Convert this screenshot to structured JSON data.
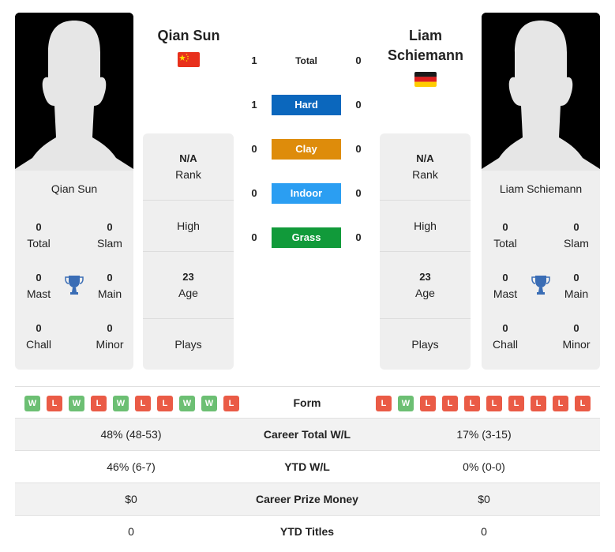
{
  "players": {
    "left": {
      "name": "Qian Sun",
      "country": "China",
      "flag_icon": "china-flag-icon",
      "rank": "N/A",
      "rank_label": "Rank",
      "high_label": "High",
      "age": "23",
      "age_label": "Age",
      "plays_label": "Plays",
      "titles": {
        "total": "0",
        "total_label": "Total",
        "slam": "0",
        "slam_label": "Slam",
        "mast": "0",
        "mast_label": "Mast",
        "main": "0",
        "main_label": "Main",
        "chall": "0",
        "chall_label": "Chall",
        "minor": "0",
        "minor_label": "Minor"
      },
      "form": [
        "W",
        "L",
        "W",
        "L",
        "W",
        "L",
        "L",
        "W",
        "W",
        "L"
      ]
    },
    "right": {
      "name": "Liam Schiemann",
      "name_line1": "Liam",
      "name_line2": "Schiemann",
      "country": "Germany",
      "flag_icon": "germany-flag-icon",
      "rank": "N/A",
      "rank_label": "Rank",
      "high_label": "High",
      "age": "23",
      "age_label": "Age",
      "plays_label": "Plays",
      "titles": {
        "total": "0",
        "total_label": "Total",
        "slam": "0",
        "slam_label": "Slam",
        "mast": "0",
        "mast_label": "Mast",
        "main": "0",
        "main_label": "Main",
        "chall": "0",
        "chall_label": "Chall",
        "minor": "0",
        "minor_label": "Minor"
      },
      "form": [
        "L",
        "W",
        "L",
        "L",
        "L",
        "L",
        "L",
        "L",
        "L",
        "L"
      ]
    }
  },
  "h2h": [
    {
      "label": "Total",
      "left": "1",
      "right": "0",
      "color": null
    },
    {
      "label": "Hard",
      "left": "1",
      "right": "0",
      "color": "#0b67bd"
    },
    {
      "label": "Clay",
      "left": "0",
      "right": "0",
      "color": "#de8c0b"
    },
    {
      "label": "Indoor",
      "left": "0",
      "right": "0",
      "color": "#2b9ef2"
    },
    {
      "label": "Grass",
      "left": "0",
      "right": "0",
      "color": "#119a3a"
    }
  ],
  "form_label": "Form",
  "stats": [
    {
      "label": "Career Total W/L",
      "left": "48% (48-53)",
      "right": "17% (3-15)"
    },
    {
      "label": "YTD W/L",
      "left": "46% (6-7)",
      "right": "0% (0-0)"
    },
    {
      "label": "Career Prize Money",
      "left": "$0",
      "right": "$0"
    },
    {
      "label": "YTD Titles",
      "left": "0",
      "right": "0"
    }
  ],
  "colors": {
    "win": "#6cbf73",
    "loss": "#ea5b46",
    "trophy": "#3a6db5"
  }
}
